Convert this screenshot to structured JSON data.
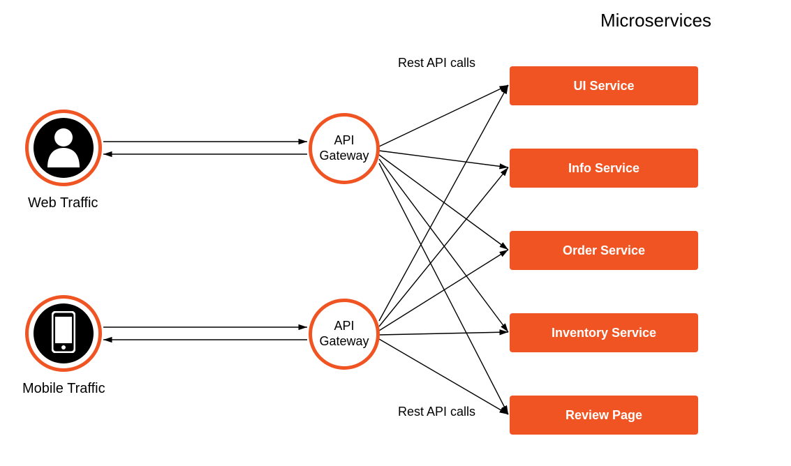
{
  "title": "Microservices",
  "clients": {
    "web": {
      "label": "Web Traffic"
    },
    "mobile": {
      "label": "Mobile Traffic"
    }
  },
  "gateways": {
    "top": {
      "label": "API\nGateway"
    },
    "bottom": {
      "label": "API\nGateway"
    }
  },
  "restLabels": {
    "top": "Rest API calls",
    "bottom": "Rest API calls"
  },
  "services": [
    {
      "id": "ui",
      "label": "UI Service"
    },
    {
      "id": "info",
      "label": "Info Service"
    },
    {
      "id": "order",
      "label": "Order Service"
    },
    {
      "id": "inventory",
      "label": "Inventory Service"
    },
    {
      "id": "review",
      "label": "Review Page"
    }
  ],
  "colors": {
    "accent": "#f05423"
  }
}
